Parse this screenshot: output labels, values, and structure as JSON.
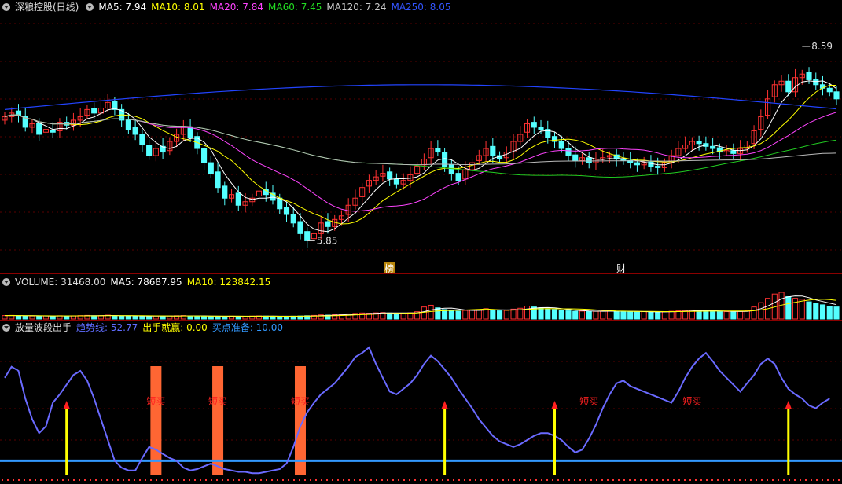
{
  "main_header": {
    "title": "深粮控股(日线)",
    "ma5": "MA5: 7.94",
    "ma10": "MA10: 8.01",
    "ma20": "MA20: 7.84",
    "ma60": "MA60: 7.45",
    "ma120": "MA120: 7.24",
    "ma250": "MA250: 8.05"
  },
  "vol_header": {
    "title": "VOLUME: 31468.00",
    "ma5": "MA5: 78687.95",
    "ma10": "MA10: 123842.15"
  },
  "ind_header": {
    "title": "放量波段出手",
    "trend": "趋势线: 52.77",
    "buy": "出手就赢: 0.00",
    "ready": "买点准备: 10.00"
  },
  "colors": {
    "up": "#ff3232",
    "down": "#54ffff",
    "ma5": "#ffffff",
    "ma10": "#ffff00",
    "ma20": "#ff44ff",
    "ma60": "#22cc22",
    "ma120": "#bbbbbb",
    "ma250": "#2244ff",
    "trend": "#6a6aff",
    "bar": "#ff6633",
    "arrow": "#ffff00",
    "base": "#3399ff"
  },
  "chart_data": [
    {
      "type": "candlestick",
      "title": "深粮控股(日线)",
      "ylim": [
        5.5,
        9.0
      ],
      "annotations": [
        {
          "label": "5.85",
          "value": 5.85
        },
        {
          "label": "8.59",
          "value": 8.59
        },
        {
          "label": "榜"
        },
        {
          "label": "财"
        }
      ],
      "close": [
        7.6,
        7.65,
        7.62,
        7.45,
        7.5,
        7.35,
        7.42,
        7.38,
        7.52,
        7.48,
        7.55,
        7.6,
        7.7,
        7.65,
        7.72,
        7.8,
        7.7,
        7.55,
        7.42,
        7.35,
        7.2,
        7.05,
        7.15,
        7.1,
        7.25,
        7.35,
        7.45,
        7.3,
        7.15,
        6.95,
        6.8,
        6.6,
        6.45,
        6.5,
        6.35,
        6.4,
        6.45,
        6.55,
        6.5,
        6.42,
        6.3,
        6.22,
        6.1,
        5.95,
        5.85,
        5.95,
        6.1,
        6.05,
        6.15,
        6.2,
        6.35,
        6.45,
        6.6,
        6.7,
        6.75,
        6.8,
        6.72,
        6.65,
        6.7,
        6.78,
        6.9,
        7.0,
        7.15,
        7.1,
        6.9,
        6.8,
        6.7,
        6.85,
        6.95,
        7.05,
        7.15,
        7.05,
        7.0,
        7.1,
        7.25,
        7.35,
        7.5,
        7.45,
        7.42,
        7.3,
        7.25,
        7.15,
        7.05,
        6.98,
        7.02,
        6.95,
        7.0,
        7.02,
        7.05,
        7.0,
        6.98,
        6.95,
        6.92,
        6.95,
        6.9,
        6.88,
        6.95,
        7.05,
        7.15,
        7.2,
        7.25,
        7.22,
        7.18,
        7.15,
        7.1,
        7.12,
        7.08,
        7.15,
        7.2,
        7.4,
        7.6,
        7.85,
        8.05,
        8.1,
        7.95,
        8.15,
        8.2,
        8.12,
        8.05,
        8.0,
        7.95,
        7.85
      ],
      "open": [
        7.55,
        7.6,
        7.68,
        7.6,
        7.45,
        7.5,
        7.38,
        7.4,
        7.4,
        7.52,
        7.48,
        7.55,
        7.62,
        7.72,
        7.65,
        7.72,
        7.82,
        7.7,
        7.55,
        7.45,
        7.35,
        7.2,
        7.05,
        7.18,
        7.12,
        7.25,
        7.35,
        7.45,
        7.32,
        7.15,
        6.95,
        6.82,
        6.62,
        6.45,
        6.52,
        6.35,
        6.4,
        6.48,
        6.58,
        6.52,
        6.45,
        6.32,
        6.22,
        6.12,
        5.98,
        5.88,
        5.95,
        6.12,
        6.05,
        6.15,
        6.22,
        6.35,
        6.47,
        6.62,
        6.7,
        6.76,
        6.82,
        6.72,
        6.65,
        6.7,
        6.8,
        6.92,
        7.02,
        7.15,
        7.1,
        6.92,
        6.8,
        6.72,
        6.85,
        6.98,
        7.05,
        7.18,
        7.05,
        7.02,
        7.1,
        7.25,
        7.38,
        7.52,
        7.45,
        7.42,
        7.32,
        7.25,
        7.15,
        7.06,
        6.98,
        7.02,
        6.95,
        7.0,
        7.03,
        7.06,
        7.0,
        6.98,
        6.95,
        6.92,
        6.96,
        6.9,
        6.88,
        6.95,
        7.05,
        7.15,
        7.2,
        7.25,
        7.22,
        7.18,
        7.16,
        7.1,
        7.12,
        7.08,
        7.15,
        7.22,
        7.42,
        7.62,
        7.88,
        8.05,
        8.1,
        7.95,
        8.15,
        8.22,
        8.12,
        8.05,
        8.0,
        7.95
      ]
    },
    {
      "type": "bar",
      "title": "VOLUME",
      "values": [
        40,
        42,
        38,
        36,
        35,
        34,
        36,
        33,
        38,
        35,
        37,
        40,
        42,
        38,
        40,
        45,
        38,
        35,
        36,
        34,
        33,
        32,
        35,
        34,
        36,
        38,
        40,
        36,
        34,
        33,
        32,
        30,
        31,
        33,
        30,
        32,
        34,
        36,
        34,
        32,
        30,
        31,
        33,
        35,
        38,
        42,
        48,
        45,
        50,
        55,
        60,
        65,
        70,
        68,
        72,
        75,
        70,
        65,
        68,
        72,
        85,
        140,
        160,
        130,
        110,
        95,
        90,
        100,
        105,
        110,
        120,
        105,
        95,
        100,
        115,
        125,
        150,
        140,
        130,
        120,
        110,
        100,
        95,
        90,
        92,
        88,
        90,
        92,
        95,
        90,
        88,
        85,
        84,
        86,
        82,
        80,
        85,
        90,
        95,
        100,
        105,
        98,
        92,
        90,
        88,
        86,
        85,
        90,
        95,
        140,
        190,
        240,
        290,
        310,
        260,
        240,
        230,
        200,
        180,
        165,
        150,
        140
      ]
    },
    {
      "type": "line",
      "title": "放量波段出手",
      "series": [
        {
          "name": "趋势线",
          "values": [
            70,
            78,
            75,
            55,
            40,
            30,
            35,
            52,
            58,
            65,
            72,
            75,
            68,
            55,
            40,
            25,
            10,
            5,
            3,
            3,
            12,
            20,
            18,
            15,
            12,
            10,
            5,
            3,
            4,
            6,
            8,
            6,
            4,
            3,
            2,
            2,
            1,
            1,
            2,
            3,
            4,
            8,
            20,
            35,
            45,
            52,
            58,
            62,
            66,
            72,
            78,
            85,
            88,
            92,
            80,
            70,
            60,
            58,
            62,
            66,
            72,
            80,
            86,
            82,
            76,
            70,
            62,
            55,
            48,
            40,
            34,
            28,
            24,
            22,
            20,
            22,
            25,
            28,
            30,
            30,
            28,
            25,
            20,
            16,
            18,
            26,
            36,
            48,
            58,
            66,
            68,
            64,
            62,
            60,
            58,
            56,
            54,
            52,
            60,
            70,
            78,
            84,
            88,
            82,
            75,
            70,
            65,
            60,
            66,
            72,
            80,
            84,
            80,
            70,
            62,
            58,
            55,
            50,
            48,
            52,
            55
          ]
        },
        {
          "name": "出手就赢",
          "values": [
            0
          ]
        },
        {
          "name": "买点准备",
          "values": [
            10
          ]
        }
      ],
      "signals": [
        {
          "label": "短买",
          "index": 22
        },
        {
          "label": "短买",
          "index": 31
        },
        {
          "label": "短买",
          "index": 43
        },
        {
          "label": "短买",
          "index": 85
        },
        {
          "label": "短买",
          "index": 100
        }
      ]
    }
  ]
}
